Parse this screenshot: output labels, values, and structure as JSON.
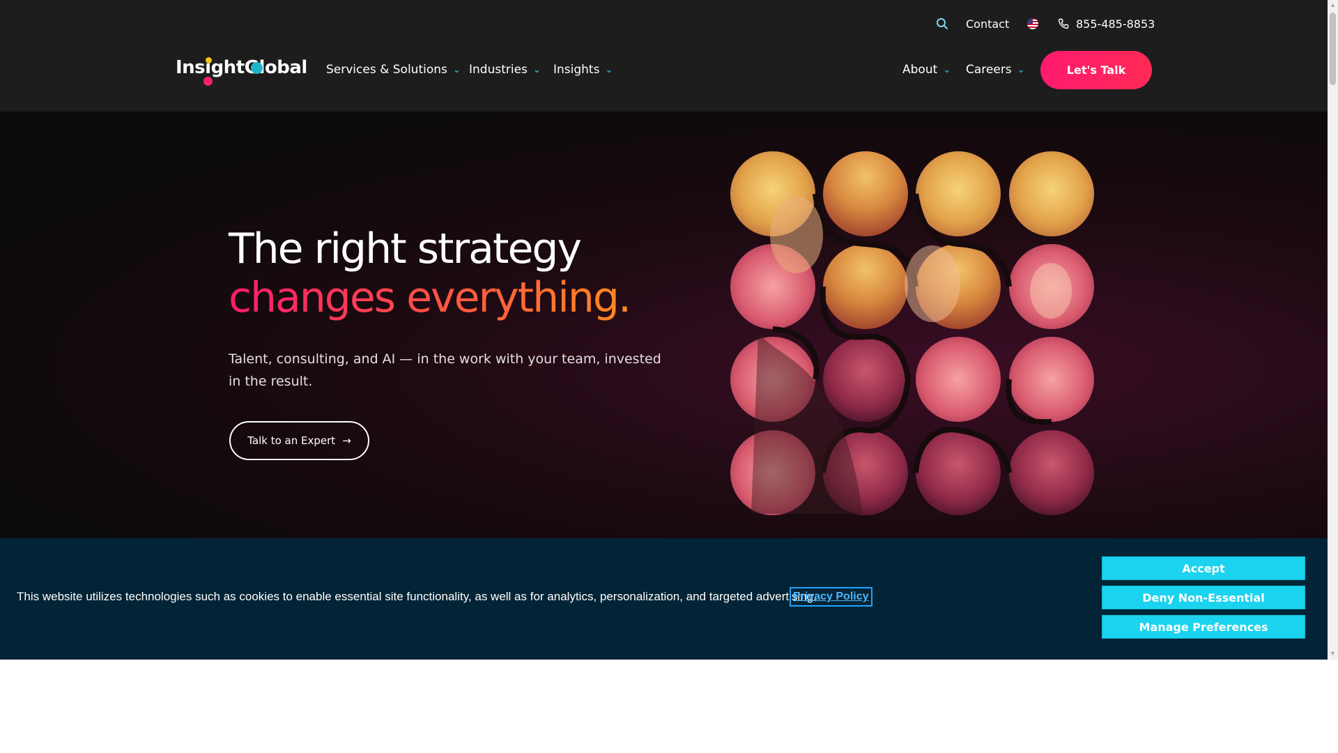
{
  "header": {
    "contact_label": "Contact",
    "phone_number": "855-485-8853",
    "logo_text": "InsightGlobal",
    "nav": {
      "services_label": "Services & Solutions",
      "industries_label": "Industries",
      "insights_label": "Insights",
      "about_label": "About",
      "careers_label": "Careers"
    },
    "cta_label": "Let's Talk",
    "icons": {
      "search": "search-icon",
      "flag": "us-flag-icon",
      "phone": "phone-icon",
      "chevron": "chevron-down-icon"
    }
  },
  "hero": {
    "headline_line1": "The right strategy",
    "headline_line2": "changes everything.",
    "subtext": "Talent, consulting, and AI — in the work with your team, invested in the result.",
    "cta_label": "Talk to an Expert",
    "cta_icon": "arrow-right-icon"
  },
  "cookie_banner": {
    "text": "This website utilizes technologies such as cookies to enable essential site functionality, as well as for analytics, personalization, and targeted advertising.",
    "privacy_link": "Privacy Policy",
    "accept_label": "Accept",
    "deny_label": "Deny Non-Essential",
    "manage_label": "Manage Preferences"
  },
  "colors": {
    "header_bg": "#1d1d1d",
    "accent_pink": "#ff1a6f",
    "accent_orange": "#ff8a1f",
    "accent_cyan": "#1fb5c9",
    "cookie_bg": "#032436",
    "cookie_button": "#1bd3ee"
  }
}
